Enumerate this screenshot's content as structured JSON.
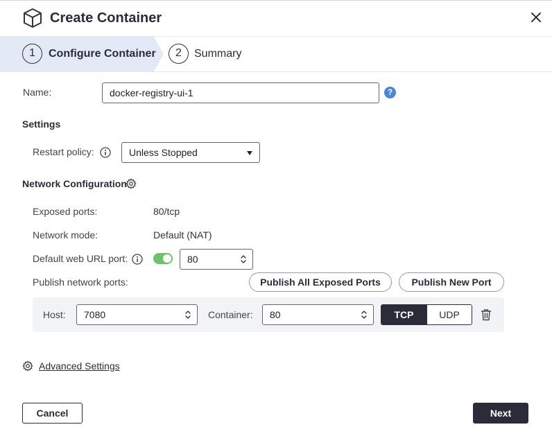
{
  "dialog": {
    "title": "Create Container",
    "close_icon": "close-icon",
    "title_icon": "cube-icon"
  },
  "steps": [
    {
      "number": "1",
      "label": "Configure Container",
      "active": true
    },
    {
      "number": "2",
      "label": "Summary",
      "active": false
    }
  ],
  "name": {
    "label": "Name:",
    "value": "docker-registry-ui-1",
    "help": "?"
  },
  "settings": {
    "title": "Settings",
    "restart_policy_label": "Restart policy:",
    "restart_policy_value": "Unless Stopped"
  },
  "network": {
    "title": "Network Configuration",
    "exposed_ports_label": "Exposed ports:",
    "exposed_ports_value": "80/tcp",
    "network_mode_label": "Network mode:",
    "network_mode_value": "Default (NAT)",
    "web_url_port_label": "Default web URL port:",
    "web_url_port_enabled": true,
    "web_url_port_value": "80",
    "publish_ports_label": "Publish network ports:",
    "publish_all_label": "Publish All Exposed Ports",
    "publish_new_label": "Publish New Port",
    "port_mapping": {
      "host_label": "Host:",
      "host_value": "7080",
      "container_label": "Container:",
      "container_value": "80",
      "protocols": [
        "TCP",
        "UDP"
      ],
      "selected_protocol": "TCP"
    }
  },
  "advanced_settings_label": "Advanced Settings",
  "footer": {
    "cancel_label": "Cancel",
    "next_label": "Next"
  },
  "colors": {
    "primary": "#2b2b3a",
    "toggle_on": "#6cc46a",
    "help_blue": "#4a86d8",
    "active_step_bg": "#e4e9f6"
  }
}
